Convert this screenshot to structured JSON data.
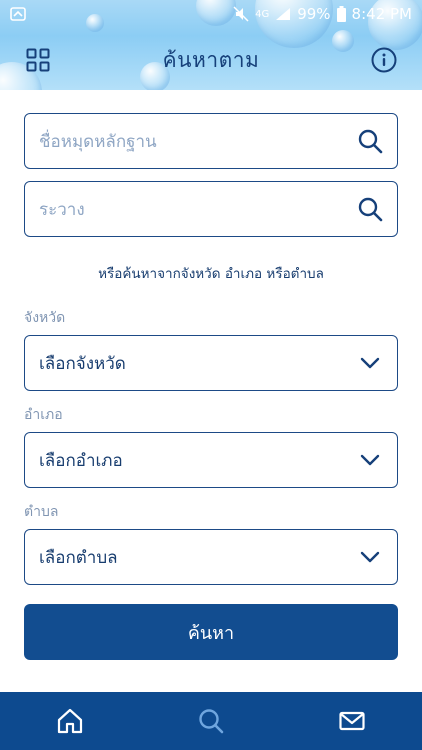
{
  "status_bar": {
    "network": "4G",
    "battery": "99%",
    "time": "8:42 PM"
  },
  "header": {
    "title": "ค้นหาตาม",
    "left_icon": "grid-menu-icon",
    "right_icon": "info-icon"
  },
  "search": {
    "name_placeholder": "ชื่อหมุดหลักฐาน",
    "district_placeholder": "ระวาง",
    "helper_text": "หรือค้นหาจากจังหวัด อำเภอ หรือตำบล"
  },
  "filters": {
    "province_label": "จังหวัด",
    "province_value": "เลือกจังหวัด",
    "amphoe_label": "อำเภอ",
    "amphoe_value": "เลือกอำเภอ",
    "tambon_label": "ตำบล",
    "tambon_value": "เลือกตำบล"
  },
  "submit_label": "ค้นหา",
  "bottom_nav": {
    "items": [
      "home-icon",
      "search-icon",
      "mail-icon"
    ],
    "active": "search-icon"
  },
  "colors": {
    "primary": "#124d90",
    "border": "#1d4a86",
    "placeholder": "#8fa6c4",
    "nav_active": "#6fa6df"
  }
}
